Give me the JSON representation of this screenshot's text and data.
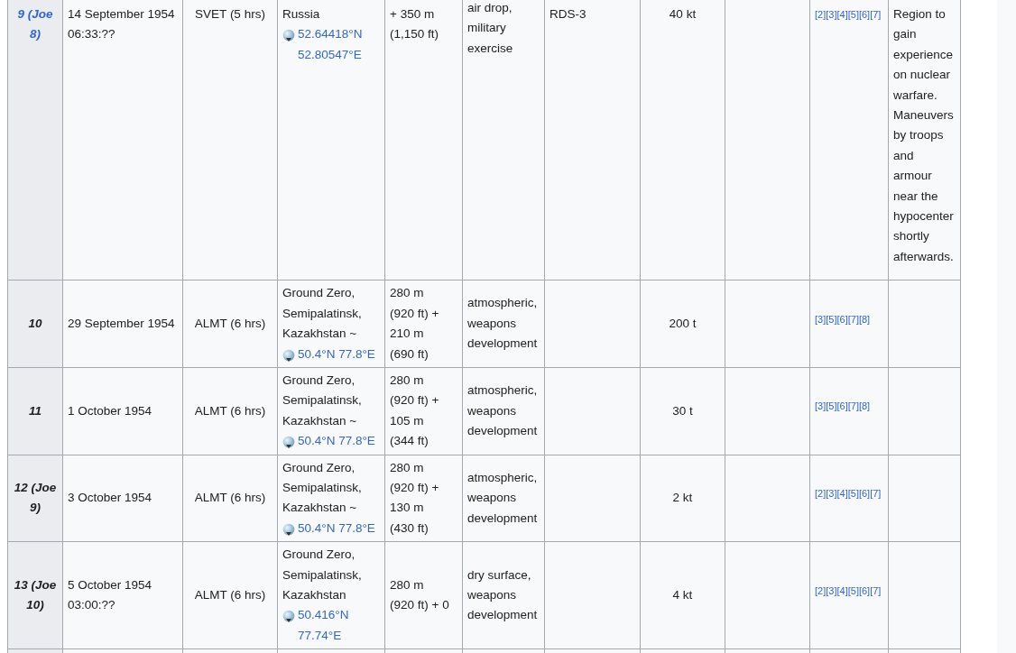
{
  "table": {
    "rows": [
      {
        "column_1": {
          "text": "9 (Joe 8)",
          "link": true
        },
        "column_2": "14 September 1954 06:33:??",
        "column_3": "SVET (5 hrs)",
        "column_4": {
          "text": "Russia",
          "coordinates": "52.64418°N 52.80547°E"
        },
        "column_5": "+ 350 m (1,150 ft)",
        "column_6": "air drop, military exercise",
        "column_7": "RDS-3",
        "column_8": "40 kt",
        "column_10": [
          "[2]",
          "[3]",
          "[4]",
          "[5]",
          "[6]",
          "[7]"
        ],
        "column_11": "Region to gain experience on nuclear warfare. Maneuvers by troops and armour near the hypocenter shortly afterwards."
      },
      {
        "column_1": {
          "text": "10",
          "link": false
        },
        "column_2": "29 September 1954",
        "column_3": "ALMT (6 hrs)",
        "column_4": {
          "text": "Ground Zero, Semipalatinsk, Kazakhstan ~",
          "coordinates": "50.4°N 77.8°E"
        },
        "column_5": "280 m (920 ft) + 210 m (690 ft)",
        "column_6": "atmospheric, weapons development",
        "column_8": "200 t",
        "column_10": [
          "[3]",
          "[5]",
          "[6]",
          "[7]",
          "[8]"
        ]
      },
      {
        "column_1": {
          "text": "11",
          "link": false
        },
        "column_2": "1 October 1954",
        "column_3": "ALMT (6 hrs)",
        "column_4": {
          "text": "Ground Zero, Semipalatinsk, Kazakhstan ~",
          "coordinates": "50.4°N 77.8°E"
        },
        "column_5": "280 m (920 ft) + 105 m (344 ft)",
        "column_6": "atmospheric, weapons development",
        "column_8": "30 t",
        "column_10": [
          "[3]",
          "[5]",
          "[6]",
          "[7]",
          "[8]"
        ]
      },
      {
        "column_1": {
          "text": "12 (Joe 9)",
          "link": false
        },
        "column_2": "3 October 1954",
        "column_3": "ALMT (6 hrs)",
        "column_4": {
          "text": "Ground Zero, Semipalatinsk, Kazakhstan ~",
          "coordinates": "50.4°N 77.8°E"
        },
        "column_5": "280 m (920 ft) + 130 m (430 ft)",
        "column_6": "atmospheric, weapons development",
        "column_8": "2 kt",
        "column_10": [
          "[2]",
          "[3]",
          "[4]",
          "[5]",
          "[6]",
          "[7]"
        ]
      },
      {
        "column_1": {
          "text": "13 (Joe 10)",
          "link": false
        },
        "column_2": "5 October 1954 03:00:??",
        "column_3": "ALMT (6 hrs)",
        "column_4": {
          "text": "Ground Zero, Semipalatinsk, Kazakhstan",
          "coordinates": "50.416°N 77.74°E"
        },
        "column_5": "280 m (920 ft) + 0",
        "column_6": "dry surface, weapons development",
        "column_8": "4 kt",
        "column_10": [
          "[2]",
          "[3]",
          "[4]",
          "[5]",
          "[6]",
          "[7]"
        ]
      }
    ]
  }
}
